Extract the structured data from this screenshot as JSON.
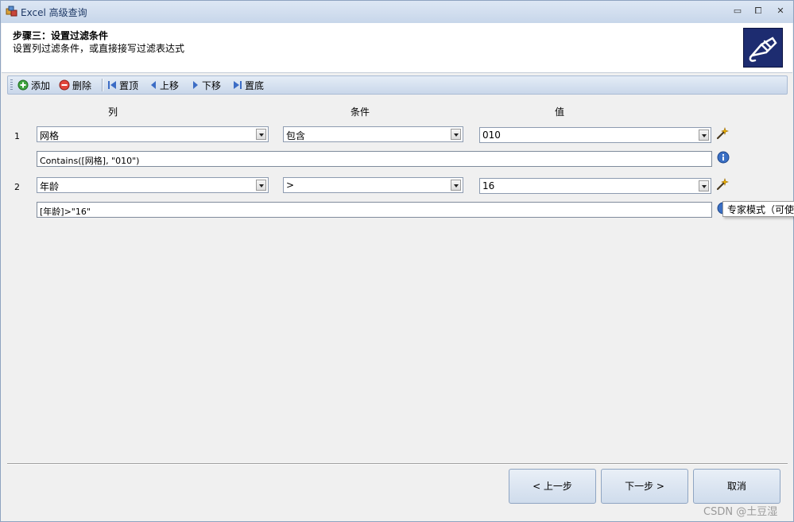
{
  "window": {
    "title": "Excel 高级查询",
    "min_glyph": "▭",
    "max_glyph": "⧠",
    "close_glyph": "✕"
  },
  "header": {
    "step_title": "步骤三：设置过滤条件",
    "step_desc": "设置列过滤条件，或直接接写过滤表达式"
  },
  "toolbar": {
    "add": "添加",
    "delete": "删除",
    "top": "置顶",
    "up": "上移",
    "down": "下移",
    "bottom": "置底"
  },
  "columns": {
    "column": "列",
    "condition": "条件",
    "value": "值"
  },
  "rows": [
    {
      "num": "1",
      "column": "网格",
      "condition": "包含",
      "value": "010",
      "expression": "Contains([网格], \"010\")"
    },
    {
      "num": "2",
      "column": "年龄",
      "condition": ">",
      "value": "16",
      "expression": "[年龄]>\"16\""
    }
  ],
  "tooltip": "专家模式（可使",
  "buttons": {
    "prev": "< 上一步",
    "next": "下一步 >",
    "cancel": "取消"
  },
  "watermark": "CSDN @土豆湿",
  "colors": {
    "header_logo_bg": "#1d2c70",
    "toolbar_bg": "#dce6f3",
    "info_icon": "#3a6fc4"
  }
}
